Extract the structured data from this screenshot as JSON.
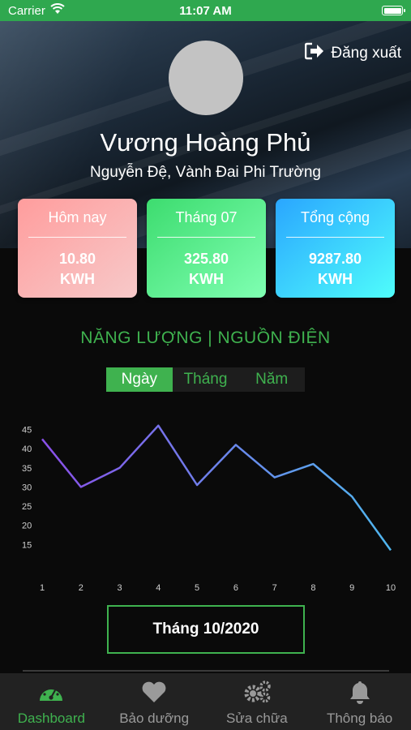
{
  "status_bar": {
    "carrier": "Carrier",
    "time": "11:07 AM"
  },
  "header": {
    "logout_label": "Đăng xuất",
    "user_name": "Vương Hoàng Phủ",
    "user_address": "Nguyễn Đệ, Vành Đai Phi Trường"
  },
  "cards": [
    {
      "title": "Hôm nay",
      "value": "10.80",
      "unit": "KWH",
      "gradient": [
        "#ff9d9d",
        "#f7c9c9"
      ]
    },
    {
      "title": "Tháng 07",
      "value": "325.80",
      "unit": "KWH",
      "gradient": [
        "#3ddc6f",
        "#7fffb2"
      ]
    },
    {
      "title": "Tổng cộng",
      "value": "9287.80",
      "unit": "KWH",
      "gradient": [
        "#2aa6ff",
        "#4ffdfb"
      ]
    }
  ],
  "section_title": "NĂNG LƯỢNG | NGUỒN ĐIỆN",
  "segment": {
    "options": [
      "Ngày",
      "Tháng",
      "Năm"
    ],
    "selected": "Ngày"
  },
  "chart_data": {
    "type": "line",
    "x": [
      1,
      2,
      3,
      4,
      5,
      6,
      7,
      8,
      9,
      10
    ],
    "series": [
      {
        "values": [
          42.5,
          30,
          35,
          46,
          30.5,
          41,
          32.5,
          36,
          27.5,
          13.5
        ]
      }
    ],
    "ylim": [
      10,
      47
    ],
    "yticks": [
      15,
      20,
      25,
      30,
      35,
      40,
      45
    ],
    "xticks": [
      1,
      2,
      3,
      4,
      5,
      6,
      7,
      8,
      9,
      10
    ],
    "grid": false,
    "line_gradient": [
      "#8a4fe8",
      "#4fb6ee"
    ]
  },
  "month_label": "Tháng 10/2020",
  "tabbar": {
    "items": [
      {
        "label": "Dashboard",
        "icon": "speedometer-icon",
        "active": true
      },
      {
        "label": "Bảo dưỡng",
        "icon": "heart-icon",
        "active": false
      },
      {
        "label": "Sửa chữa",
        "icon": "gears-icon",
        "active": false
      },
      {
        "label": "Thông báo",
        "icon": "bell-icon",
        "active": false
      }
    ]
  },
  "colors": {
    "accent": "#3fb24f",
    "background": "#0a0a0a",
    "tabbar": "#222222"
  }
}
